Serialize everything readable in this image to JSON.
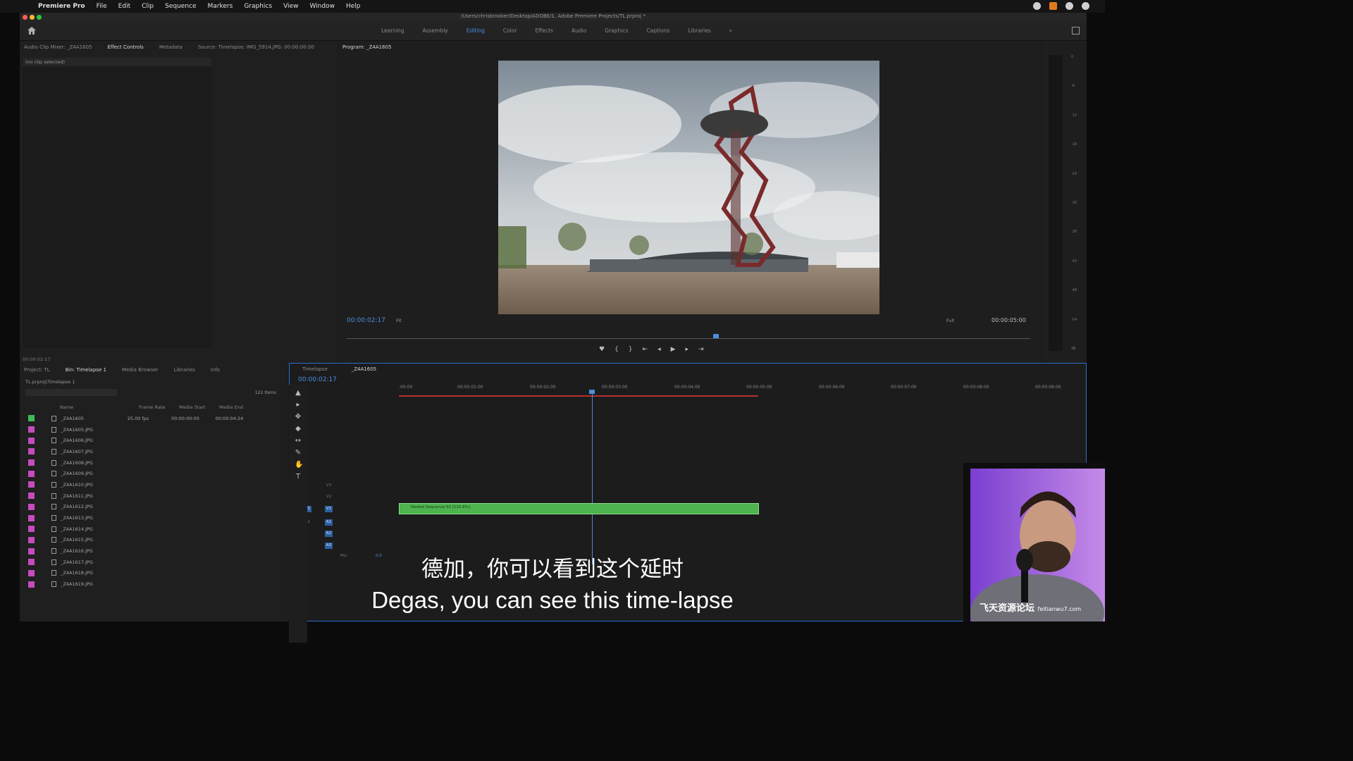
{
  "menubar": {
    "app": "Premiere Pro",
    "items": [
      "File",
      "Edit",
      "Clip",
      "Sequence",
      "Markers",
      "Graphics",
      "View",
      "Window",
      "Help"
    ]
  },
  "window": {
    "path": "/Users/chrisbrooker/Desktop/ADOBE/1. Adobe Premiere Projects/TL.prproj *"
  },
  "workspaces": {
    "tabs": [
      "Learning",
      "Assembly",
      "Editing",
      "Color",
      "Effects",
      "Audio",
      "Graphics",
      "Captions",
      "Libraries"
    ],
    "active": "Editing",
    "more": "»"
  },
  "source_panel": {
    "tabs": [
      "Audio Clip Mixer: _Z4A1605",
      "Effect Controls",
      "Metadata",
      "Source: Timelapse: IMG_5914.JPG: 00:00:00:00"
    ],
    "active": "Effect Controls",
    "no_clip": "(no clip selected)",
    "timecode": "00:00:02:17"
  },
  "program": {
    "title": "Program: _Z4A1605",
    "timecode": "00:00:02:17",
    "fit": "Fit",
    "resolution": "Full",
    "duration": "00:00:05:00",
    "controls": [
      "♥",
      "{",
      "}",
      "⇤",
      "◂",
      "▶",
      "▸",
      "⇥"
    ]
  },
  "meter": {
    "scale": [
      "0",
      "-3",
      "-6",
      "-9",
      "-12",
      "-15",
      "-18",
      "-21",
      "-24",
      "-27",
      "-30",
      "-33",
      "-36",
      "-39",
      "-42",
      "-45",
      "-48",
      "-51",
      "-54",
      "-57",
      "dB"
    ]
  },
  "project": {
    "tabs": [
      "Project: TL",
      "Bin: Timelapse 1",
      "Media Browser",
      "Libraries",
      "Info"
    ],
    "active": "Bin: Timelapse 1",
    "path": "TL.prproj\\Timelapse 1",
    "count": "122 Items",
    "columns": [
      "Name",
      "Frame Rate",
      "Media Start",
      "Media End"
    ],
    "rows": [
      {
        "name": "_Z4A1605",
        "rate": "25.00 fps",
        "start": "00:00:00:00",
        "end": "00:00:04:24",
        "color": "#3dbb5a",
        "type": "seq"
      },
      {
        "name": "_Z4A1605.JPG",
        "rate": "",
        "start": "",
        "end": "",
        "color": "#c64bbd",
        "type": "img"
      },
      {
        "name": "_Z4A1606.JPG",
        "rate": "",
        "start": "",
        "end": "",
        "color": "#c64bbd",
        "type": "img"
      },
      {
        "name": "_Z4A1607.JPG",
        "rate": "",
        "start": "",
        "end": "",
        "color": "#c64bbd",
        "type": "img"
      },
      {
        "name": "_Z4A1608.JPG",
        "rate": "",
        "start": "",
        "end": "",
        "color": "#c64bbd",
        "type": "img"
      },
      {
        "name": "_Z4A1609.JPG",
        "rate": "",
        "start": "",
        "end": "",
        "color": "#c64bbd",
        "type": "img"
      },
      {
        "name": "_Z4A1610.JPG",
        "rate": "",
        "start": "",
        "end": "",
        "color": "#c64bbd",
        "type": "img"
      },
      {
        "name": "_Z4A1611.JPG",
        "rate": "",
        "start": "",
        "end": "",
        "color": "#c64bbd",
        "type": "img"
      },
      {
        "name": "_Z4A1612.JPG",
        "rate": "",
        "start": "",
        "end": "",
        "color": "#c64bbd",
        "type": "img"
      },
      {
        "name": "_Z4A1613.JPG",
        "rate": "",
        "start": "",
        "end": "",
        "color": "#c64bbd",
        "type": "img"
      },
      {
        "name": "_Z4A1614.JPG",
        "rate": "",
        "start": "",
        "end": "",
        "color": "#c64bbd",
        "type": "img"
      },
      {
        "name": "_Z4A1615.JPG",
        "rate": "",
        "start": "",
        "end": "",
        "color": "#c64bbd",
        "type": "img"
      },
      {
        "name": "_Z4A1616.JPG",
        "rate": "",
        "start": "",
        "end": "",
        "color": "#c64bbd",
        "type": "img"
      },
      {
        "name": "_Z4A1617.JPG",
        "rate": "",
        "start": "",
        "end": "",
        "color": "#c64bbd",
        "type": "img"
      },
      {
        "name": "_Z4A1618.JPG",
        "rate": "",
        "start": "",
        "end": "",
        "color": "#c64bbd",
        "type": "img"
      },
      {
        "name": "_Z4A1619.JPG",
        "rate": "",
        "start": "",
        "end": "",
        "color": "#c64bbd",
        "type": "img"
      }
    ]
  },
  "timeline": {
    "tabs": [
      "Timelapse",
      "_Z4A1605"
    ],
    "active": "_Z4A1605",
    "timecode": "00:00:02:17",
    "ruler": [
      ":00:00",
      "00:00:01:00",
      "00:00:02:00",
      "00:00:03:00",
      "00:00:04:00",
      "00:00:05:00",
      "00:00:06:00",
      "00:00:07:00",
      "00:00:08:00",
      "00:00:09:00"
    ],
    "video_tracks": [
      "V3",
      "V2",
      "V1"
    ],
    "audio_tracks": [
      "A1",
      "A2",
      "A3"
    ],
    "source_v": "V1",
    "source_a": "A1",
    "mix_label": "Mix",
    "mix_value": "0.0",
    "clip_label": "Nested Sequence 02 [120.8%]",
    "clip_color": "#4fb34f"
  },
  "subtitles": {
    "zh": "德加，你可以看到这个延时",
    "en": "Degas, you can see this time-lapse"
  },
  "watermark": {
    "text": "飞天资源论坛",
    "small": "feitianwu7.com"
  },
  "colors": {
    "accent": "#4a8fe0",
    "timeline_border": "#2a6fcc",
    "workarea": "#b53131"
  }
}
